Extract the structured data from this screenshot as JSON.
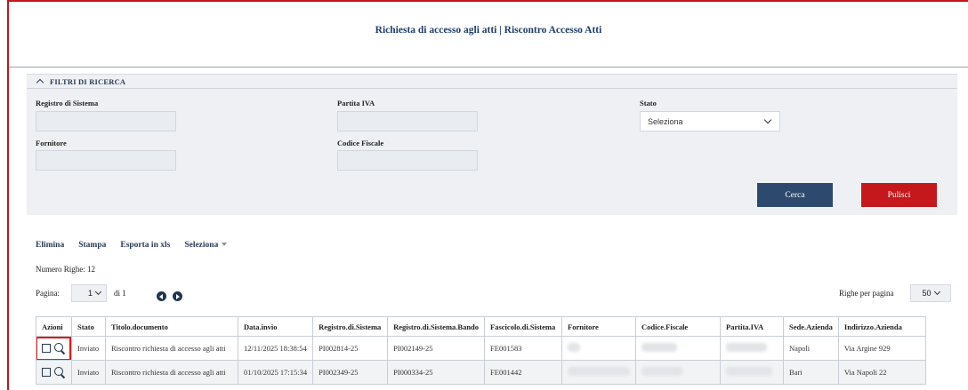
{
  "header": {
    "title": "Richiesta di accesso agli atti | Riscontro Accesso Atti"
  },
  "filters": {
    "heading": "FILTRI DI RICERCA",
    "registro_label": "Registro di Sistema",
    "partita_label": "Partita IVA",
    "stato_label": "Stato",
    "stato_value": "Seleziona",
    "fornitore_label": "Fornitore",
    "codice_label": "Codice Fiscale",
    "search_button": "Cerca",
    "clear_button": "Pulisci"
  },
  "toolbar": {
    "elimina": "Elimina",
    "stampa": "Stampa",
    "esporta": "Esporta in xls",
    "seleziona": "Seleziona"
  },
  "pagination": {
    "row_count": "Numero Righe: 12",
    "page_label": "Pagina:",
    "page_value": "1",
    "of_label": "di 1",
    "rows_per_page_label": "Righe per pagina",
    "rows_per_page_value": "50"
  },
  "table": {
    "headers": [
      "Azioni",
      "Stato",
      "Titolo.documento",
      "Data.invio",
      "Registro.di.Sistema",
      "Registro.di.Sistema.Bando",
      "Fascicolo.di.Sistema",
      "Fornitore",
      "Codice.Fiscale",
      "Partita.IVA",
      "Sede.Azienda",
      "Indirizzo.Azienda"
    ],
    "rows": [
      {
        "stato": "Inviato",
        "titolo": "Riscontro richiesta di accesso agli atti",
        "data": "12/11/2025 18:38:54",
        "registro": "PI002814-25",
        "bando": "PI002149-25",
        "fascicolo": "FE001583",
        "sede": "Napoli",
        "indirizzo": "Via Argine 929"
      },
      {
        "stato": "Inviato",
        "titolo": "Riscontro richiesta di accesso agli atti",
        "data": "01/10/2025 17:15:34",
        "registro": "PI002349-25",
        "bando": "PI000334-25",
        "fascicolo": "FE001442",
        "sede": "Bari",
        "indirizzo": "Via Napoli 22"
      }
    ]
  },
  "colors": {
    "accent_red": "#c5181c",
    "navy": "#2d4a6e",
    "title_blue": "#1f3d6b"
  }
}
